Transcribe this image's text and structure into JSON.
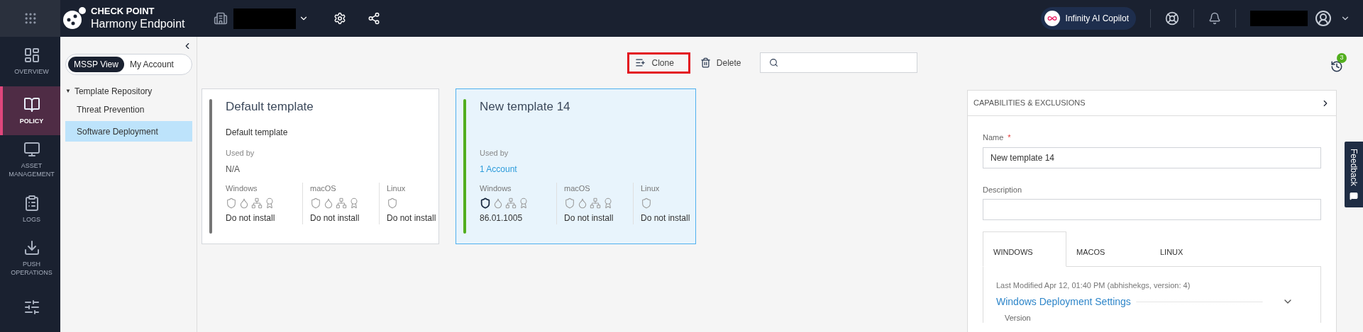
{
  "topbar": {
    "brand": "CHECK POINT",
    "product": "Harmony Endpoint",
    "copilot": "Infinity AI Copilot"
  },
  "nav": [
    {
      "label": "OVERVIEW",
      "kind": "overview",
      "selected": false
    },
    {
      "label": "POLICY",
      "kind": "policy",
      "selected": true
    },
    {
      "label": "ASSET MANAGEMENT",
      "kind": "assets",
      "selected": false
    },
    {
      "label": "LOGS",
      "kind": "logs",
      "selected": false
    },
    {
      "label": "PUSH OPERATIONS",
      "kind": "push",
      "selected": false
    },
    {
      "kind": "sliders",
      "selected": false
    }
  ],
  "tree": {
    "views": [
      {
        "label": "MSSP View",
        "selected": true
      },
      {
        "label": "My Account",
        "selected": false
      }
    ],
    "root": {
      "label": "Template Repository",
      "expanded": true,
      "expanded_glyph": "▼",
      "children": [
        {
          "label": "Threat Prevention",
          "selected": false
        },
        {
          "label": "Software Deployment",
          "selected": true
        }
      ]
    }
  },
  "toolbar": {
    "buttons": [
      {
        "label": "Clone",
        "kind": "clone",
        "highlighted": true
      },
      {
        "label": "Delete",
        "kind": "delete",
        "highlighted": false
      }
    ],
    "history_badge": "3"
  },
  "templates": [
    {
      "title": "Default template",
      "description": "Default template",
      "selected": false,
      "color": "#757575",
      "used_by_label": "Used by",
      "used_by": "N/A",
      "used_by_link": false,
      "os": [
        {
          "name": "Windows",
          "icons": [
            {
              "kind": "shield",
              "active": false
            },
            {
              "kind": "drop",
              "active": false
            },
            {
              "kind": "nodes",
              "active": false
            },
            {
              "kind": "award",
              "active": false
            }
          ],
          "status": "Do not install"
        },
        {
          "name": "macOS",
          "icons": [
            {
              "kind": "shield",
              "active": false
            },
            {
              "kind": "drop",
              "active": false
            },
            {
              "kind": "nodes",
              "active": false
            },
            {
              "kind": "award",
              "active": false
            }
          ],
          "status": "Do not install"
        },
        {
          "name": "Linux",
          "icons": [
            {
              "kind": "shield",
              "active": false
            }
          ],
          "status": "Do not install"
        }
      ]
    },
    {
      "title": "New template 14",
      "selected": true,
      "color": "#52ae1e",
      "used_by_label": "Used by",
      "used_by": "1 Account",
      "used_by_link": true,
      "os": [
        {
          "name": "Windows",
          "icons": [
            {
              "kind": "shield",
              "active": true
            },
            {
              "kind": "drop",
              "active": false
            },
            {
              "kind": "nodes",
              "active": false
            },
            {
              "kind": "award",
              "active": false
            }
          ],
          "status": "86.01.1005"
        },
        {
          "name": "macOS",
          "icons": [
            {
              "kind": "shield",
              "active": false
            },
            {
              "kind": "drop",
              "active": false
            },
            {
              "kind": "nodes",
              "active": false
            },
            {
              "kind": "award",
              "active": false
            }
          ],
          "status": "Do not install"
        },
        {
          "name": "Linux",
          "icons": [
            {
              "kind": "shield",
              "active": false
            }
          ],
          "status": "Do not install"
        }
      ]
    }
  ],
  "details": {
    "title": "CAPABILITIES & EXCLUSIONS",
    "required_mark": "*",
    "fields": [
      {
        "label": "Name",
        "required": true,
        "value": "New template 14"
      },
      {
        "label": "Description",
        "required": false
      }
    ],
    "tabs": [
      {
        "label": "WINDOWS",
        "selected": true
      },
      {
        "label": "MACOS",
        "selected": false
      },
      {
        "label": "LINUX",
        "selected": false
      }
    ],
    "last_modified": "Last Modified Apr 12, 01:40 PM (abhishekgs, version: 4)",
    "section": "Windows Deployment Settings",
    "field_label": "Version"
  },
  "feedback": "Feedback"
}
